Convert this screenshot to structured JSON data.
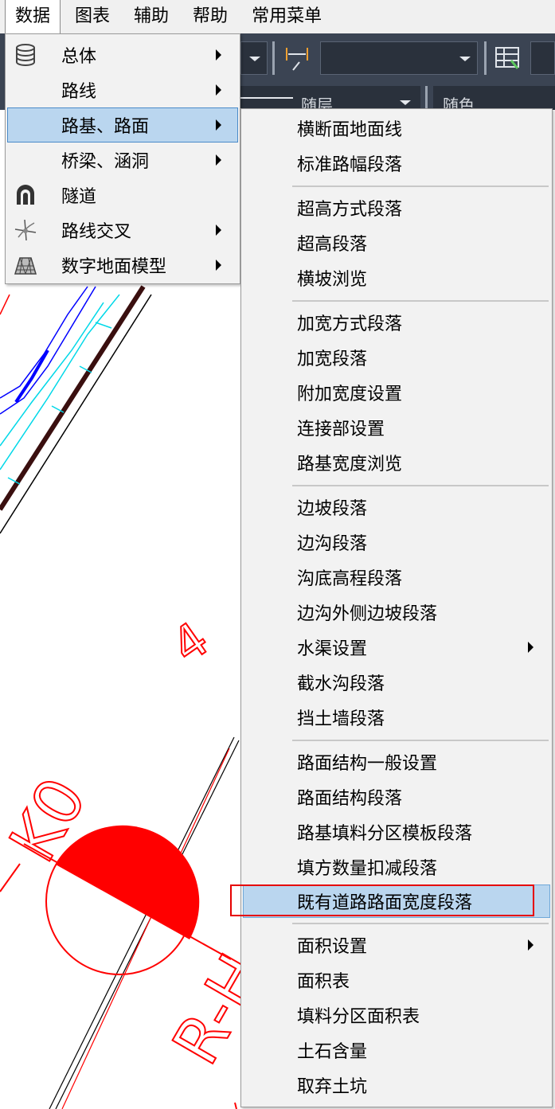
{
  "menubar": {
    "items": [
      {
        "label": "数据"
      },
      {
        "label": "图表"
      },
      {
        "label": "辅助"
      },
      {
        "label": "帮助"
      },
      {
        "label": "常用菜单"
      }
    ]
  },
  "toolbar": {
    "layer_label": "随层",
    "color_label": "随色"
  },
  "menu1": {
    "items": [
      {
        "label": "总体",
        "icon": "database-icon",
        "submenu": true
      },
      {
        "label": "路线",
        "icon": "",
        "submenu": true
      },
      {
        "label": "路基、路面",
        "icon": "",
        "submenu": true
      },
      {
        "label": "桥梁、涵洞",
        "icon": "",
        "submenu": true
      },
      {
        "label": "隧道",
        "icon": "tunnel-icon",
        "submenu": false
      },
      {
        "label": "路线交叉",
        "icon": "intersection-icon",
        "submenu": true
      },
      {
        "label": "数字地面模型",
        "icon": "terrain-icon",
        "submenu": true
      }
    ]
  },
  "menu2": {
    "items": [
      {
        "label": "横断面地面线"
      },
      {
        "label": "标准路幅段落"
      },
      {
        "label": "超高方式段落"
      },
      {
        "label": "超高段落"
      },
      {
        "label": "横坡浏览"
      },
      {
        "label": "加宽方式段落"
      },
      {
        "label": "加宽段落"
      },
      {
        "label": "附加宽度设置"
      },
      {
        "label": "连接部设置"
      },
      {
        "label": "路基宽度浏览"
      },
      {
        "label": "边坡段落"
      },
      {
        "label": "边沟段落"
      },
      {
        "label": "沟底高程段落"
      },
      {
        "label": "边沟外侧边坡段落"
      },
      {
        "label": "水渠设置"
      },
      {
        "label": "截水沟段落"
      },
      {
        "label": "挡土墙段落"
      },
      {
        "label": "路面结构一般设置"
      },
      {
        "label": "路面结构段落"
      },
      {
        "label": "路基填料分区模板段落"
      },
      {
        "label": "填方数量扣减段落"
      },
      {
        "label": "既有道路路面宽度段落"
      },
      {
        "label": "面积设置"
      },
      {
        "label": "面积表"
      },
      {
        "label": "填料分区面积表"
      },
      {
        "label": "土石含量"
      },
      {
        "label": "取弃土坑"
      }
    ]
  },
  "canvas": {
    "text_1": "4",
    "text_2": "K0",
    "text_3": "R-H"
  },
  "colors": {
    "menu_bg": "#f2f2f2",
    "highlight": "#bad6ef",
    "toolbar": "#3b4453",
    "cad_red": "#ff0000",
    "cad_blue": "#0000ff",
    "cad_cyan": "#00e5ee"
  }
}
